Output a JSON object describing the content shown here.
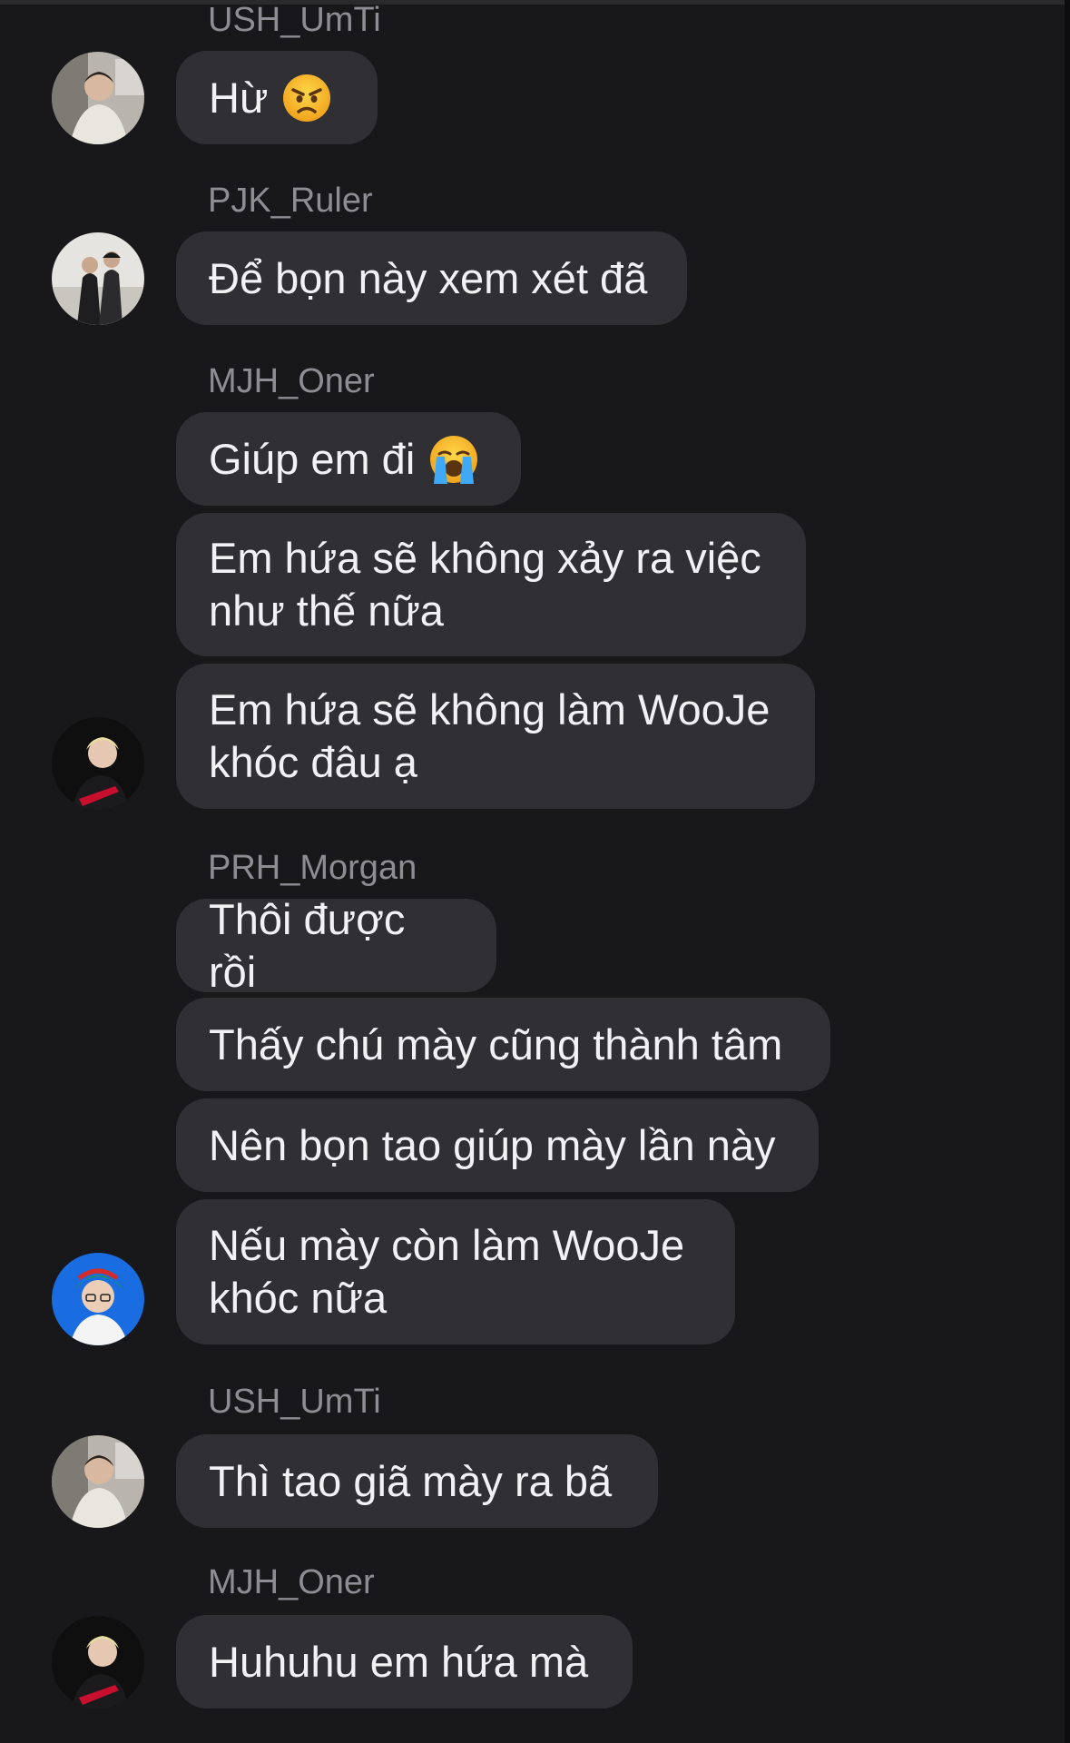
{
  "messages": [
    {
      "sender": "USH_UmTi",
      "text": "Hừ",
      "emoji": "angry-face-icon"
    },
    {
      "sender": "PJK_Ruler",
      "text": "Để bọn này xem xét đã"
    },
    {
      "sender": "MJH_Oner",
      "text": "Giúp em đi",
      "emoji": "loudly-crying-face-icon"
    },
    {
      "text": "Em hứa sẽ không xảy ra việc\nnhư thế nữa"
    },
    {
      "text": "Em hứa sẽ không làm WooJe\nkhóc đâu ạ"
    },
    {
      "sender": "PRH_Morgan",
      "text": "Thôi được rồi"
    },
    {
      "text": "Thấy chú mày cũng thành tâm"
    },
    {
      "text": "Nên bọn tao giúp mày lần này"
    },
    {
      "text": "Nếu mày còn làm WooJe\nkhóc nữa"
    },
    {
      "sender": "USH_UmTi",
      "text": "Thì tao giã mày ra bã"
    },
    {
      "sender": "MJH_Oner",
      "text": "Huhuhu em hứa mà"
    }
  ],
  "colors": {
    "background": "#18181a",
    "bubble": "#303034",
    "sender": "#8d8d93",
    "text": "#f2f2f4"
  }
}
